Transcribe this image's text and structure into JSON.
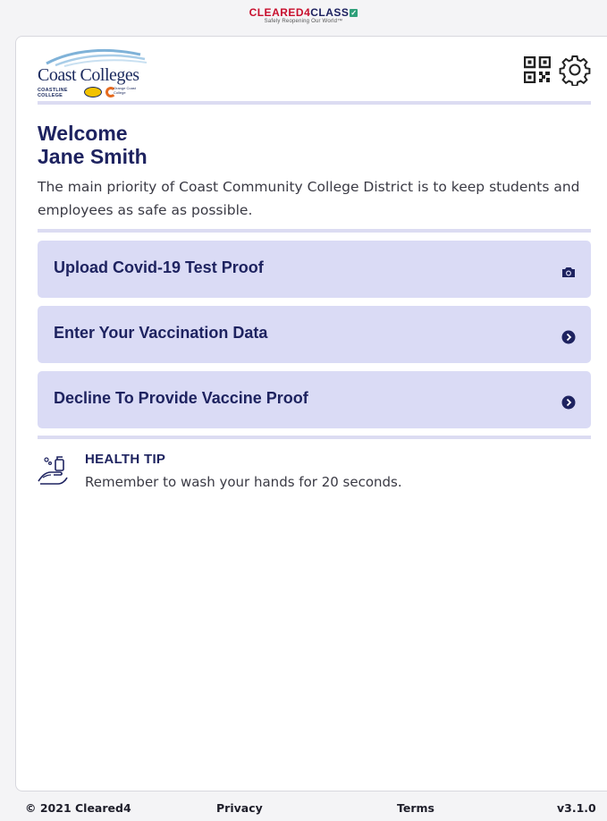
{
  "brand": {
    "part1": "CLEARED4",
    "part2": "CLASS",
    "check": "✓",
    "tagline": "Safely Reopening Our World™"
  },
  "logo": {
    "title": "Coast Colleges",
    "coastline": "COASTLINE",
    "coastline_sub": "COLLEGE",
    "occ_text": "Orange Coast College"
  },
  "header": {
    "qr_icon": "qr-code-icon",
    "settings_icon": "gear-icon"
  },
  "welcome": {
    "line1": "Welcome",
    "line2": "Jane Smith"
  },
  "intro": "The main priority of Coast Community College District is to keep students and employees as safe as possible.",
  "actions": [
    {
      "label": "Upload Covid-19 Test Proof",
      "icon": "camera-icon"
    },
    {
      "label": "Enter Your Vaccination Data",
      "icon": "chevron-right-circle-icon"
    },
    {
      "label": "Decline To Provide Vaccine Proof",
      "icon": "chevron-right-circle-icon"
    }
  ],
  "health_tip": {
    "icon": "hand-wash-icon",
    "title": "HEALTH TIP",
    "text": "Remember to wash your hands for 20 seconds."
  },
  "footer": {
    "copyright": "© 2021 Cleared4",
    "privacy": "Privacy",
    "terms": "Terms",
    "version": "v3.1.0"
  },
  "colors": {
    "navy": "#1e2360",
    "button_bg": "#dadbf5",
    "divider": "#dcdcf2",
    "brand_red": "#c8102e"
  }
}
